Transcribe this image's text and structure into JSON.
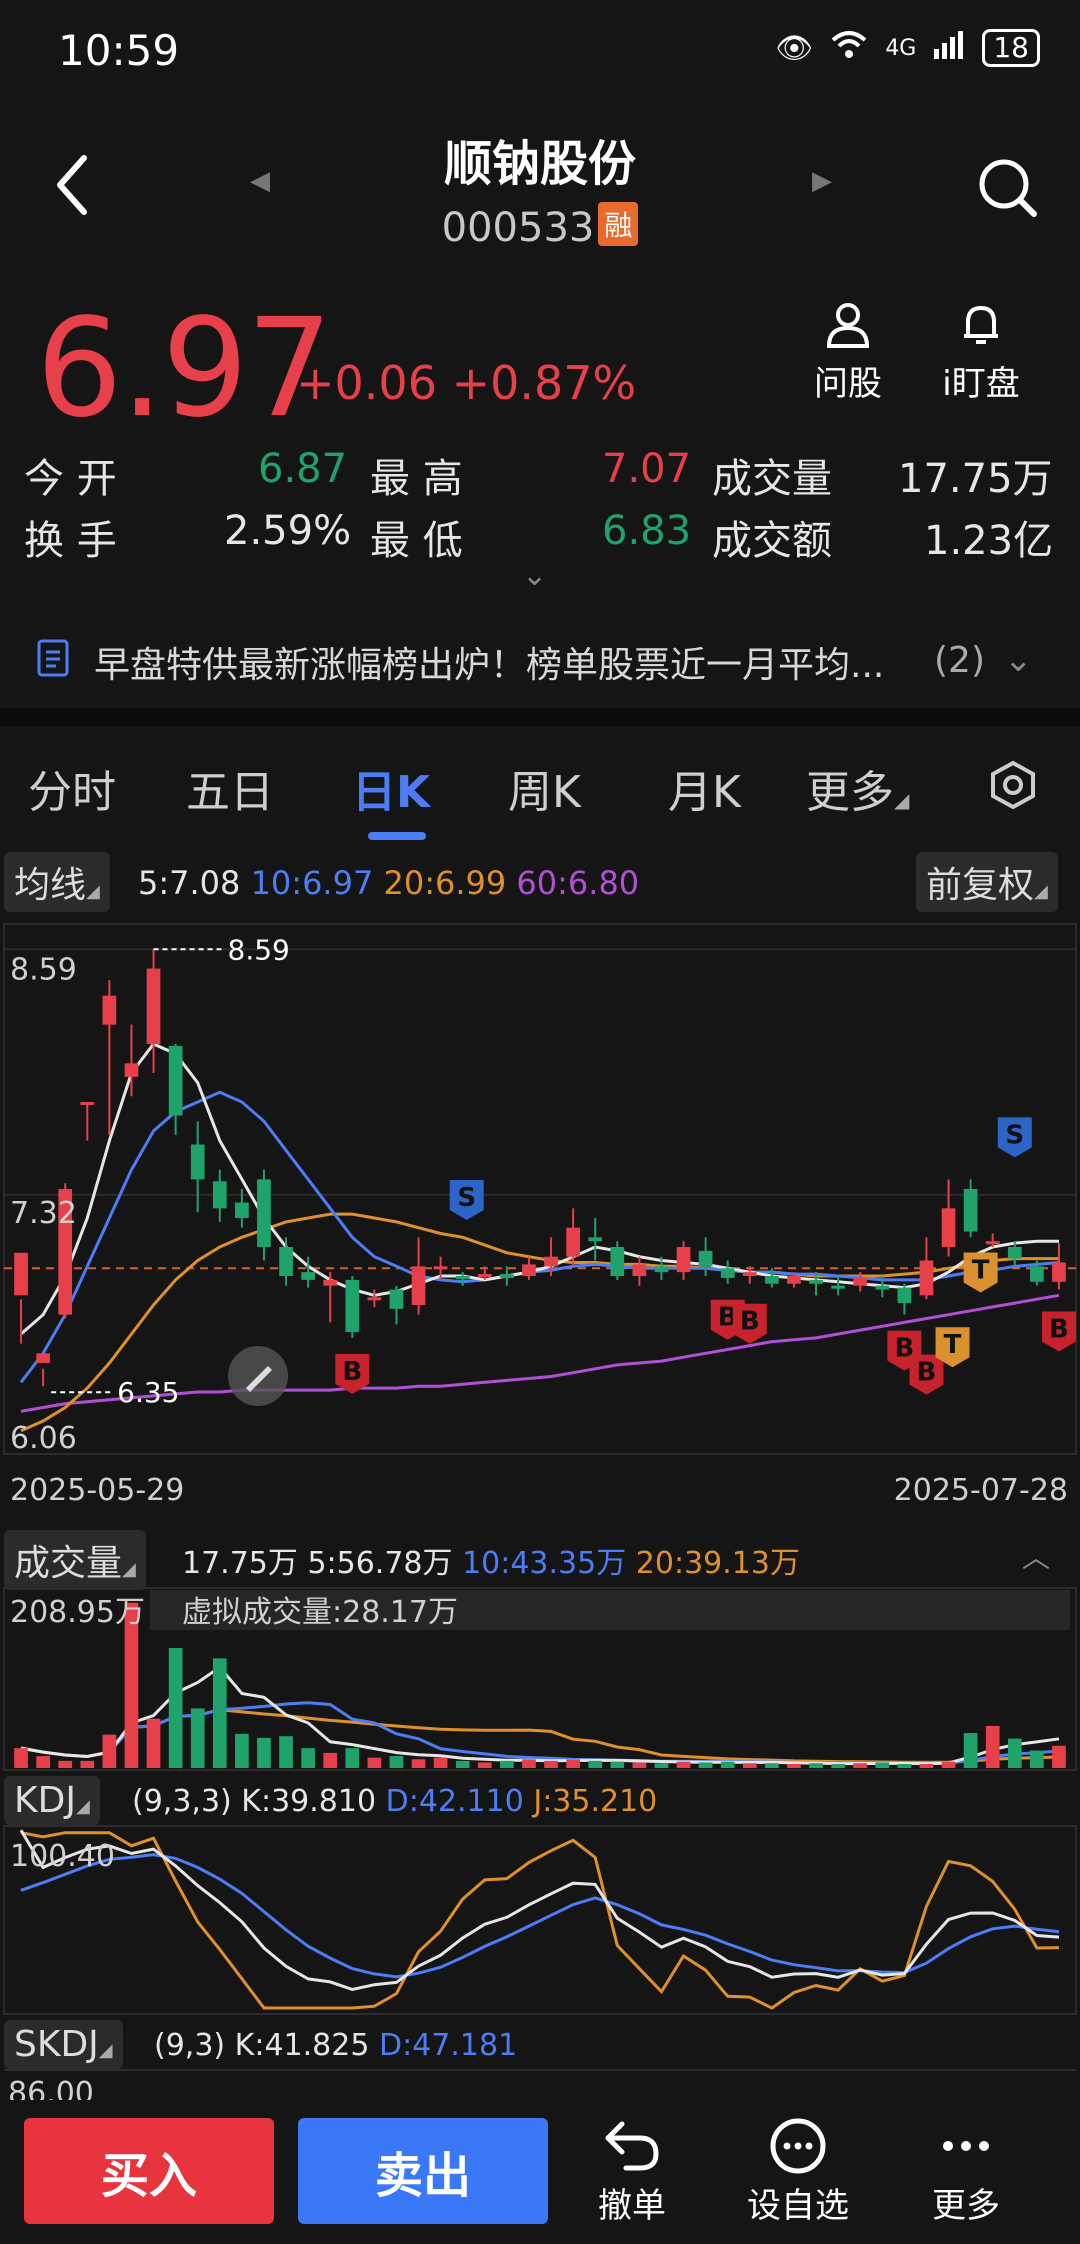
{
  "status": {
    "time": "10:59",
    "network": "4G",
    "battery": "18"
  },
  "header": {
    "name": "顺钠股份",
    "code": "000533",
    "badge": "融"
  },
  "quote": {
    "price": "6.97",
    "change": "+0.06",
    "change_pct": "+0.87%",
    "open_label": "今 开",
    "open": "6.87",
    "high_label": "最 高",
    "high": "7.07",
    "volume_label": "成交量",
    "volume": "17.75万",
    "turnover_label": "换 手",
    "turnover": "2.59%",
    "low_label": "最 低",
    "low": "6.83",
    "amount_label": "成交额",
    "amount": "1.23亿"
  },
  "actions": {
    "ask": "问股",
    "watch": "i盯盘"
  },
  "news": {
    "text": "早盘特供最新涨幅榜出炉！榜单股票近一月平均...",
    "count": "(2)"
  },
  "tabs": [
    "分时",
    "五日",
    "日K",
    "周K",
    "月K",
    "更多"
  ],
  "active_tab": "日K",
  "kline": {
    "indicator_label": "均线",
    "ma5": "5:7.08",
    "ma10": "10:6.97",
    "ma20": "20:6.99",
    "ma60": "60:6.80",
    "adjust_label": "前复权",
    "price_top": "8.59",
    "price_mid": "7.32",
    "price_bottom": "6.06",
    "max_marker": "8.59",
    "min_marker": "6.35",
    "date_start": "2025-05-29",
    "date_end": "2025-07-28",
    "marker_b": "B",
    "marker_s": "S",
    "marker_t": "T"
  },
  "volume": {
    "label": "成交量",
    "v": "17.75万",
    "ma5": "5:56.78万",
    "ma10": "10:43.35万",
    "ma20": "20:39.13万",
    "axis_top": "208.95万",
    "virtual": "虚拟成交量:28.17万"
  },
  "kdj": {
    "label": "KDJ",
    "params": "(9,3,3)",
    "k": "K:39.810",
    "d": "D:42.110",
    "j": "J:35.210",
    "axis_top": "100.40"
  },
  "skdj": {
    "label": "SKDJ",
    "params": "(9,3)",
    "k": "K:41.825",
    "d": "D:47.181",
    "axis_top": "86.00"
  },
  "bottom": {
    "buy": "买入",
    "sell": "卖出",
    "cancel": "撤单",
    "set_watch": "设自选",
    "more": "更多"
  },
  "colors": {
    "up": "#e8404a",
    "down": "#1fa36b",
    "ma5": "#e6e6e6",
    "ma10": "#4b7df5",
    "ma20": "#e0902a",
    "ma60": "#b24fd6"
  },
  "chart_data": {
    "type": "candlestick",
    "ohlc": [
      [
        6.8,
        7.02,
        6.78,
        6.55
      ],
      [
        6.45,
        6.5,
        6.42,
        6.33
      ],
      [
        6.7,
        7.35,
        7.38,
        6.68
      ],
      [
        7.8,
        7.8,
        7.8,
        7.6
      ],
      [
        8.2,
        8.35,
        8.43,
        7.63
      ],
      [
        7.93,
        8.0,
        8.2,
        7.83
      ],
      [
        8.1,
        8.49,
        8.59,
        7.95
      ],
      [
        8.09,
        7.73,
        8.1,
        7.63
      ],
      [
        7.58,
        7.4,
        7.7,
        7.23
      ],
      [
        7.39,
        7.25,
        7.45,
        7.18
      ],
      [
        7.28,
        7.2,
        7.35,
        7.15
      ],
      [
        7.4,
        7.05,
        7.45,
        6.98
      ],
      [
        7.05,
        6.9,
        7.1,
        6.85
      ],
      [
        6.92,
        6.88,
        7.0,
        6.84
      ],
      [
        6.85,
        6.88,
        6.92,
        6.66
      ],
      [
        6.88,
        6.61,
        6.9,
        6.58
      ],
      [
        6.79,
        6.79,
        6.83,
        6.74
      ],
      [
        6.83,
        6.73,
        6.85,
        6.65
      ],
      [
        6.75,
        6.95,
        7.1,
        6.7
      ],
      [
        6.95,
        6.95,
        7.0,
        6.88
      ],
      [
        6.9,
        6.89,
        6.92,
        6.85
      ],
      [
        6.91,
        6.91,
        6.95,
        6.88
      ],
      [
        6.91,
        6.89,
        6.95,
        6.85
      ],
      [
        6.9,
        6.96,
        7.0,
        6.88
      ],
      [
        6.95,
        7.0,
        7.1,
        6.9
      ],
      [
        7.0,
        7.15,
        7.25,
        6.95
      ],
      [
        7.1,
        7.08,
        7.2,
        6.98
      ],
      [
        7.05,
        6.9,
        7.08,
        6.88
      ],
      [
        6.9,
        6.96,
        7.0,
        6.85
      ],
      [
        6.95,
        6.92,
        7.0,
        6.88
      ],
      [
        6.92,
        7.05,
        7.08,
        6.88
      ],
      [
        7.03,
        6.95,
        7.1,
        6.9
      ],
      [
        6.94,
        6.89,
        6.98,
        6.86
      ],
      [
        6.9,
        6.92,
        6.95,
        6.86
      ],
      [
        6.9,
        6.86,
        6.94,
        6.84
      ],
      [
        6.86,
        6.9,
        6.92,
        6.84
      ],
      [
        6.88,
        6.86,
        6.92,
        6.8
      ],
      [
        6.85,
        6.84,
        6.9,
        6.8
      ],
      [
        6.85,
        6.89,
        6.92,
        6.82
      ],
      [
        6.85,
        6.83,
        6.9,
        6.79
      ],
      [
        6.84,
        6.76,
        6.86,
        6.7
      ],
      [
        6.8,
        6.98,
        7.1,
        6.78
      ],
      [
        7.05,
        7.25,
        7.4,
        7.0
      ],
      [
        7.35,
        7.13,
        7.4,
        7.1
      ],
      [
        7.08,
        7.08,
        7.12,
        7.05
      ],
      [
        7.05,
        6.99,
        7.08,
        6.95
      ],
      [
        6.95,
        6.87,
        6.98,
        6.85
      ],
      [
        6.87,
        6.97,
        7.07,
        6.83
      ]
    ],
    "ma5": [
      6.6,
      6.7,
      6.9,
      7.2,
      7.6,
      7.95,
      8.1,
      8.05,
      7.9,
      7.6,
      7.4,
      7.2,
      7.05,
      6.95,
      6.88,
      6.83,
      6.8,
      6.82,
      6.86,
      6.9,
      6.9,
      6.88,
      6.9,
      6.92,
      6.95,
      7.0,
      7.05,
      7.03,
      7.0,
      6.98,
      6.97,
      6.96,
      6.94,
      6.92,
      6.9,
      6.89,
      6.88,
      6.87,
      6.86,
      6.85,
      6.84,
      6.86,
      6.92,
      7.0,
      7.05,
      7.07,
      7.08,
      7.08
    ],
    "ma10": [
      6.35,
      6.5,
      6.7,
      6.95,
      7.2,
      7.45,
      7.65,
      7.75,
      7.8,
      7.85,
      7.8,
      7.7,
      7.55,
      7.4,
      7.25,
      7.1,
      7.0,
      6.95,
      6.9,
      6.88,
      6.87,
      6.88,
      6.9,
      6.92,
      6.93,
      6.95,
      6.96,
      6.95,
      6.94,
      6.94,
      6.94,
      6.94,
      6.93,
      6.92,
      6.92,
      6.91,
      6.91,
      6.9,
      6.89,
      6.88,
      6.88,
      6.88,
      6.9,
      6.92,
      6.93,
      6.95,
      6.96,
      6.97
    ],
    "ma20": [
      6.1,
      6.15,
      6.22,
      6.32,
      6.45,
      6.6,
      6.75,
      6.88,
      6.98,
      7.05,
      7.1,
      7.14,
      7.18,
      7.2,
      7.22,
      7.22,
      7.2,
      7.18,
      7.15,
      7.12,
      7.1,
      7.06,
      7.02,
      7.0,
      6.98,
      6.97,
      6.97,
      6.96,
      6.96,
      6.95,
      6.95,
      6.94,
      6.93,
      6.92,
      6.92,
      6.91,
      6.9,
      6.9,
      6.9,
      6.9,
      6.91,
      6.92,
      6.94,
      6.96,
      6.98,
      6.99,
      6.99,
      6.99
    ],
    "ma60": [
      6.2,
      6.22,
      6.24,
      6.25,
      6.26,
      6.27,
      6.28,
      6.29,
      6.3,
      6.3,
      6.31,
      6.31,
      6.31,
      6.31,
      6.31,
      6.32,
      6.32,
      6.32,
      6.33,
      6.33,
      6.34,
      6.35,
      6.36,
      6.37,
      6.38,
      6.4,
      6.42,
      6.44,
      6.45,
      6.46,
      6.48,
      6.5,
      6.52,
      6.54,
      6.56,
      6.57,
      6.58,
      6.6,
      6.62,
      6.64,
      6.66,
      6.68,
      6.7,
      6.72,
      6.74,
      6.76,
      6.78,
      6.8
    ],
    "volume": [
      25,
      15,
      9,
      9,
      42,
      208,
      62,
      151,
      75,
      138,
      43,
      38,
      40,
      25,
      19,
      25,
      13,
      15,
      11,
      13,
      9,
      7,
      9,
      11,
      9,
      11,
      9,
      8,
      7,
      6,
      8,
      7,
      8,
      6,
      6,
      5,
      6,
      5,
      6,
      7,
      5,
      5,
      8,
      44,
      53,
      37,
      22,
      28,
      17
    ]
  }
}
